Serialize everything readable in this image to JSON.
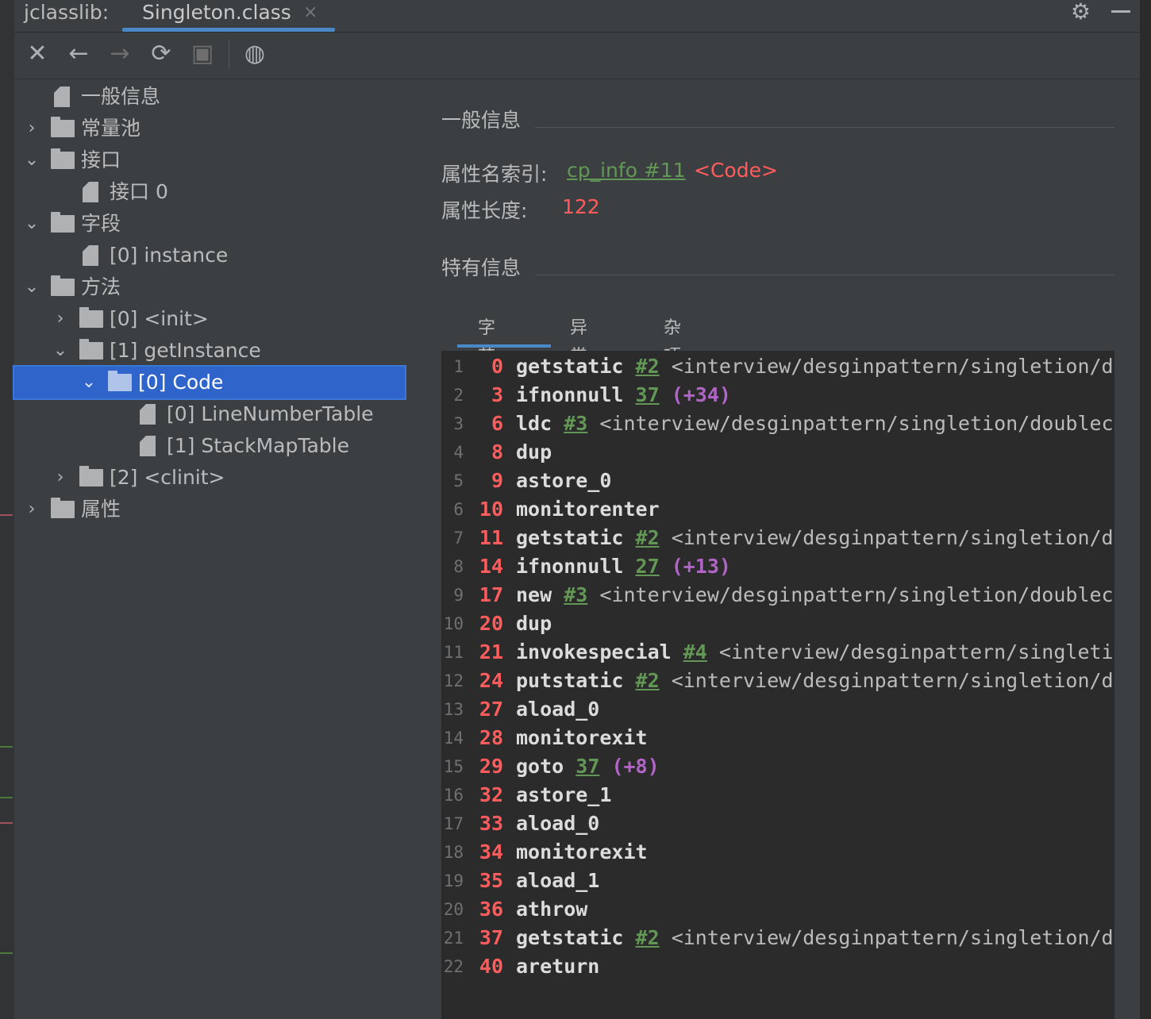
{
  "window": {
    "app_label": "jclasslib:",
    "tab_label": "Singleton.class",
    "tab_close": "×"
  },
  "toolbar": {
    "close": "✕",
    "back": "←",
    "forward": "→",
    "refresh": "⟳",
    "save": "▣",
    "web": "◍"
  },
  "tree": {
    "general": "一般信息",
    "constant_pool": "常量池",
    "interfaces": "接口",
    "interface_0": "接口 0",
    "fields": "字段",
    "field_0": "[0] instance",
    "methods": "方法",
    "method_0": "[0] <init>",
    "method_1": "[1] getInstance",
    "code": "[0] Code",
    "line_number_table": "[0] LineNumberTable",
    "stack_map_table": "[1] StackMapTable",
    "method_2": "[2] <clinit>",
    "attributes": "属性"
  },
  "panel": {
    "general_title": "一般信息",
    "attr_name_index_label": "属性名索引:",
    "attr_name_index_link": "cp_info #11",
    "attr_name_index_value": "<Code>",
    "attr_length_label": "属性长度:",
    "attr_length_value": "122",
    "specific_title": "特有信息",
    "tabs": [
      "字节码",
      "异常表",
      "杂项"
    ]
  },
  "bytecode": [
    {
      "ln": "1",
      "off": "0",
      "op": "getstatic",
      "ref": "#2",
      "cmt": "<interview/desginpattern/singletion/dou"
    },
    {
      "ln": "2",
      "off": "3",
      "op": "ifnonnull",
      "ref": "37",
      "jmp": "(+34)"
    },
    {
      "ln": "3",
      "off": "6",
      "op": "ldc",
      "ref": "#3",
      "cmt": "<interview/desginpattern/singletion/doubleche"
    },
    {
      "ln": "4",
      "off": "8",
      "op": "dup"
    },
    {
      "ln": "5",
      "off": "9",
      "op": "astore_0"
    },
    {
      "ln": "6",
      "off": "10",
      "op": "monitorenter"
    },
    {
      "ln": "7",
      "off": "11",
      "op": "getstatic",
      "ref": "#2",
      "cmt": "<interview/desginpattern/singletion/dou"
    },
    {
      "ln": "8",
      "off": "14",
      "op": "ifnonnull",
      "ref": "27",
      "jmp": "(+13)"
    },
    {
      "ln": "9",
      "off": "17",
      "op": "new",
      "ref": "#3",
      "cmt": "<interview/desginpattern/singletion/doubleche"
    },
    {
      "ln": "10",
      "off": "20",
      "op": "dup"
    },
    {
      "ln": "11",
      "off": "21",
      "op": "invokespecial",
      "ref": "#4",
      "cmt": "<interview/desginpattern/singletio"
    },
    {
      "ln": "12",
      "off": "24",
      "op": "putstatic",
      "ref": "#2",
      "cmt": "<interview/desginpattern/singletion/dou"
    },
    {
      "ln": "13",
      "off": "27",
      "op": "aload_0"
    },
    {
      "ln": "14",
      "off": "28",
      "op": "monitorexit"
    },
    {
      "ln": "15",
      "off": "29",
      "op": "goto",
      "ref": "37",
      "jmp": "(+8)"
    },
    {
      "ln": "16",
      "off": "32",
      "op": "astore_1"
    },
    {
      "ln": "17",
      "off": "33",
      "op": "aload_0"
    },
    {
      "ln": "18",
      "off": "34",
      "op": "monitorexit"
    },
    {
      "ln": "19",
      "off": "35",
      "op": "aload_1"
    },
    {
      "ln": "20",
      "off": "36",
      "op": "athrow"
    },
    {
      "ln": "21",
      "off": "37",
      "op": "getstatic",
      "ref": "#2",
      "cmt": "<interview/desginpattern/singletion/dou"
    },
    {
      "ln": "22",
      "off": "40",
      "op": "areturn"
    }
  ],
  "colors": {
    "selection": "#2f65ca",
    "link": "#629755",
    "offset": "#ff5d5d",
    "jump": "#b065c7",
    "accent": "#4a88c7"
  }
}
